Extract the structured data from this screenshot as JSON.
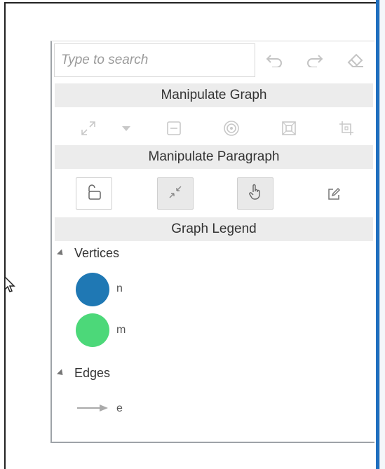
{
  "search": {
    "placeholder": "Type to search"
  },
  "toolbar": {
    "undo_icon": "undo-icon",
    "redo_icon": "redo-icon",
    "eraser_icon": "eraser-icon"
  },
  "sections": {
    "manipulate_graph": "Manipulate Graph",
    "manipulate_paragraph": "Manipulate Paragraph",
    "graph_legend": "Graph Legend"
  },
  "graph_tools": [
    "expand-icon",
    "dropdown-arrow-icon",
    "minus-box-icon",
    "target-icon",
    "frame-select-icon",
    "crop-icon"
  ],
  "paragraph_tools": [
    {
      "icon": "unlock-icon",
      "active": false
    },
    {
      "icon": "collapse-icon",
      "active": true
    },
    {
      "icon": "hand-pointer-icon",
      "active": true
    },
    {
      "icon": "edit-icon",
      "active": false
    }
  ],
  "legend": {
    "vertices_label": "Vertices",
    "vertices": [
      {
        "label": "n",
        "color": "#1f78b4"
      },
      {
        "label": "m",
        "color": "#4cd879"
      }
    ],
    "edges_label": "Edges",
    "edges": [
      {
        "label": "e",
        "color": "#aaaaaa"
      }
    ]
  }
}
